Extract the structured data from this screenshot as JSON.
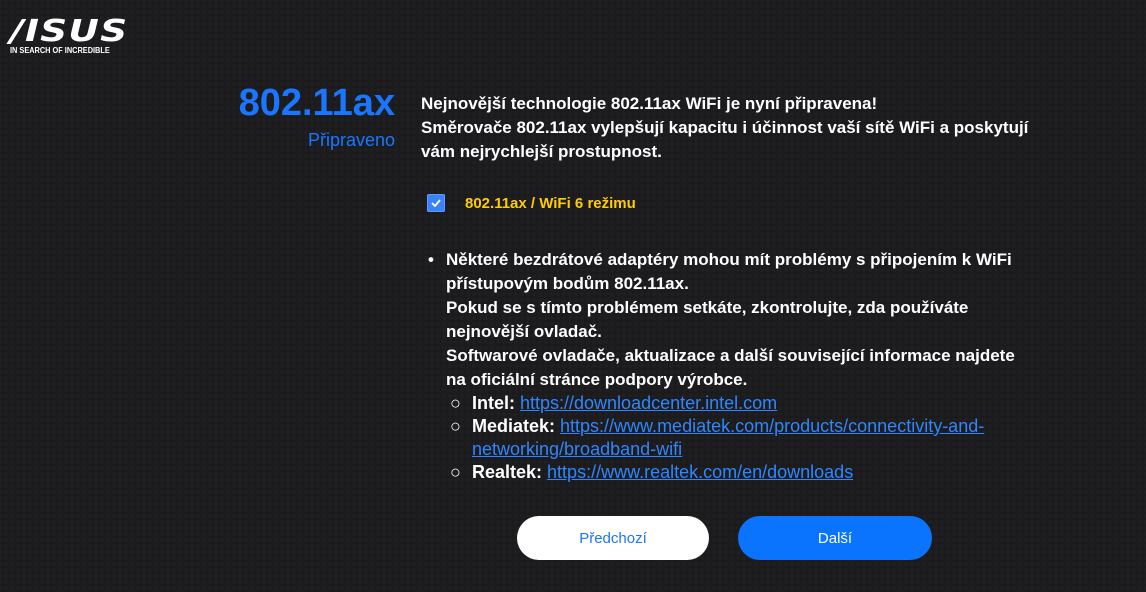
{
  "logo": {
    "brand": "/ISUS",
    "tagline": "IN SEARCH OF INCREDIBLE"
  },
  "heading": {
    "title": "802.11ax",
    "subtitle": "Připraveno"
  },
  "intro": {
    "line1": "Nejnovější technologie 802.11ax WiFi je nyní připravena!",
    "line2": "Směrovače 802.11ax vylepšují kapacitu i účinnost vaší sítě WiFi a poskytují vám nejrychlejší prostupnost."
  },
  "mode_checkbox": {
    "checked": true,
    "label": "802.11ax / WiFi 6 režimu"
  },
  "notes": {
    "bullet": "•",
    "para1": "Některé bezdrátové adaptéry mohou mít problémy s připojením k WiFi přístupovým bodům 802.11ax.",
    "para2": "Pokud se s tímto problémem setkáte, zkontrolujte, zda používáte nejnovější ovladač.",
    "para3": "Softwarové ovladače, aktualizace a další související informace najdete na oficiální stránce podpory výrobce.",
    "circle": "○",
    "links": [
      {
        "vendor": "Intel: ",
        "url": "https://downloadcenter.intel.com"
      },
      {
        "vendor": "Mediatek: ",
        "url": "https://www.mediatek.com/products/connectivity-and-networking/broadband-wifi"
      },
      {
        "vendor": "Realtek: ",
        "url": "https://www.realtek.com/en/downloads"
      }
    ]
  },
  "buttons": {
    "previous": "Předchozí",
    "next": "Další"
  },
  "colors": {
    "background": "#1b1b1d",
    "accent": "#1a76ff",
    "highlight": "#ffcc00",
    "link": "#2f86ff"
  },
  "icons": {
    "checkbox": "checkmark-icon"
  }
}
